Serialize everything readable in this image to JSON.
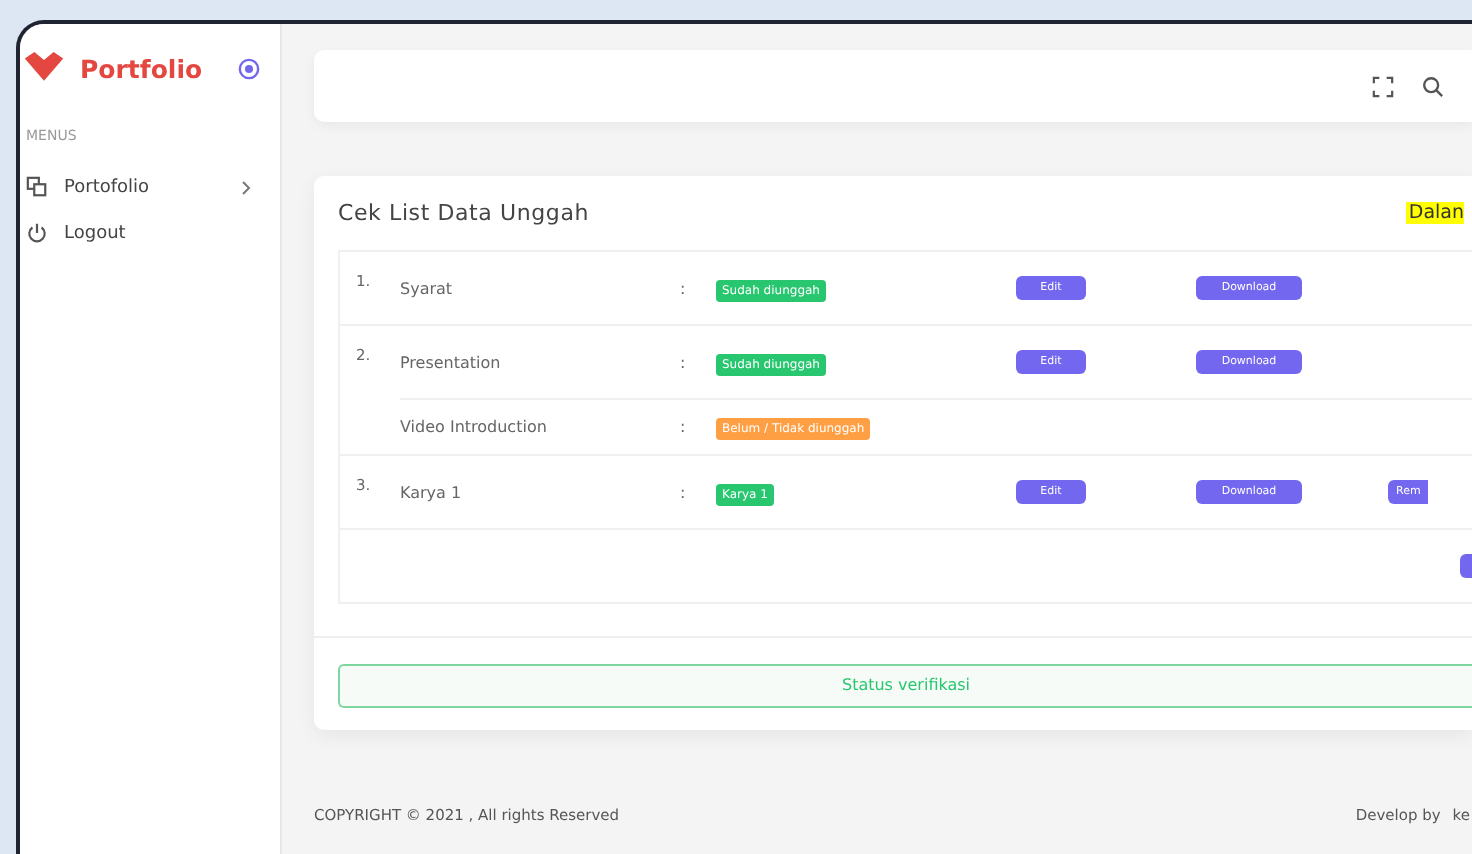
{
  "sidebar": {
    "brand": "Portfolio",
    "section_label": "MENUS",
    "items": [
      {
        "label": "Portofolio",
        "kind": "submenu"
      },
      {
        "label": "Logout",
        "kind": "logout"
      }
    ]
  },
  "card": {
    "title": "Cek List Data Unggah",
    "highlight": "Dalan",
    "rows": [
      {
        "number": "1.",
        "items": [
          {
            "name": "Syarat",
            "separator": ":",
            "status": {
              "text": "Sudah diunggah",
              "color": "#28c76f"
            },
            "actions": [
              {
                "label": "Edit"
              },
              {
                "label": "Download"
              }
            ]
          }
        ]
      },
      {
        "number": "2.",
        "items": [
          {
            "name": "Presentation",
            "separator": ":",
            "status": {
              "text": "Sudah diunggah",
              "color": "#28c76f"
            },
            "actions": [
              {
                "label": "Edit"
              },
              {
                "label": "Download"
              }
            ]
          },
          {
            "name": "Video Introduction",
            "separator": ":",
            "status": {
              "text": "Belum / Tidak diunggah",
              "color": "#ff9f43"
            }
          }
        ]
      },
      {
        "number": "3.",
        "items": [
          {
            "name": "Karya 1",
            "separator": ":",
            "status": {
              "text": "Karya 1",
              "color": "#28c76f"
            },
            "actions": [
              {
                "label": "Edit"
              },
              {
                "label": "Download"
              },
              {
                "label": "Rem"
              }
            ]
          }
        ]
      }
    ],
    "status_button": "Status verifikasi"
  },
  "footer": {
    "copyright": "COPYRIGHT © 2021 , All rights Reserved",
    "credit": "Develop by",
    "credit_name": "ke"
  }
}
